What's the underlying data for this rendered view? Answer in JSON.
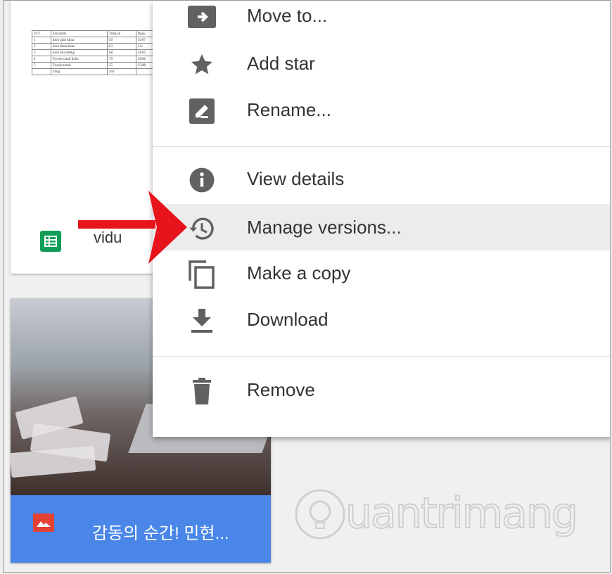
{
  "file_card": {
    "name": "vidu",
    "icon": "google-sheets-icon",
    "sheet_header": [
      "STT",
      "Sản phẩm",
      "Tổng số",
      "Ngày"
    ],
    "sheet_rows": [
      [
        "1",
        "Sách giáo khoa",
        "50",
        "15/07"
      ],
      [
        "2",
        "Sách tham khảo",
        "63",
        "5/5/"
      ],
      [
        "3",
        "Sách bồi dưỡng",
        "68",
        "14/05"
      ],
      [
        "4",
        "Truyện tranh thiếu",
        "70",
        "10/06"
      ],
      [
        "5",
        "Truyện tranh",
        "55",
        "15/08"
      ]
    ],
    "sheet_total": [
      "Tổng",
      "303"
    ]
  },
  "photo_card": {
    "name": "감동의 순간! 민현...",
    "icon": "image-file-icon"
  },
  "menu": {
    "items": [
      {
        "label": "Move to...",
        "icon": "move-to-icon"
      },
      {
        "label": "Add star",
        "icon": "star-icon"
      },
      {
        "label": "Rename...",
        "icon": "rename-icon"
      },
      {
        "label": "View details",
        "icon": "info-icon"
      },
      {
        "label": "Manage versions...",
        "icon": "history-icon",
        "highlighted": true
      },
      {
        "label": "Make a copy",
        "icon": "copy-icon"
      },
      {
        "label": "Download",
        "icon": "download-icon"
      },
      {
        "label": "Remove",
        "icon": "trash-icon"
      }
    ]
  },
  "watermark": "uantrimang",
  "colors": {
    "menu_icon": "#616161",
    "sheets_green": "#0f9d58",
    "photo_bar": "#4a86e8",
    "arrow_red": "#e8141b",
    "highlight": "#ececec"
  }
}
